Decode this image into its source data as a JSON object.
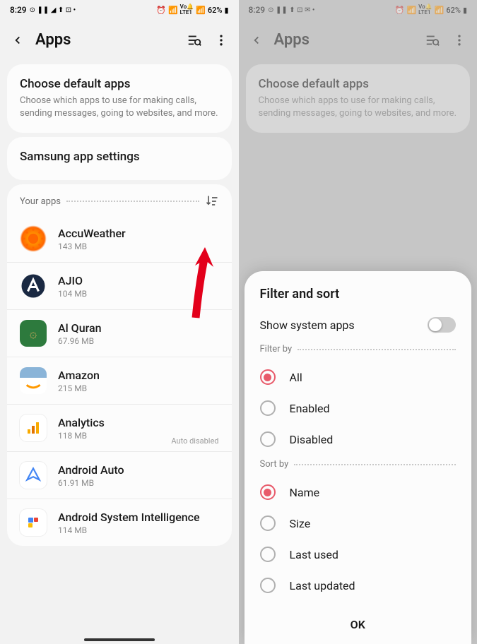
{
  "status": {
    "time": "8:29",
    "icons_left": "⊙ ⏸ ✈ ⬆ ⊡ •",
    "icons_right": "⏰ 📶",
    "lte": "VoLTE1",
    "signal": "📶",
    "battery_pct": "62%",
    "battery_icon": "🔲"
  },
  "header": {
    "title": "Apps"
  },
  "cards": {
    "default": {
      "title": "Choose default apps",
      "desc": "Choose which apps to use for making calls, sending messages, going to websites, and more."
    },
    "samsung": {
      "title": "Samsung app settings"
    }
  },
  "section": {
    "title": "Your apps"
  },
  "apps": [
    {
      "name": "AccuWeather",
      "size": "143 MB"
    },
    {
      "name": "AJIO",
      "size": "104 MB"
    },
    {
      "name": "Al Quran",
      "size": "67.96 MB"
    },
    {
      "name": "Amazon",
      "size": "215 MB"
    },
    {
      "name": "Analytics",
      "size": "118 MB",
      "tag": "Auto disabled"
    },
    {
      "name": "Android Auto",
      "size": "61.91 MB"
    },
    {
      "name": "Android System Intelligence",
      "size": "114 MB"
    }
  ],
  "sheet": {
    "title": "Filter and sort",
    "toggle_label": "Show system apps",
    "filter_label": "Filter by",
    "sort_label": "Sort by",
    "filters": [
      "All",
      "Enabled",
      "Disabled"
    ],
    "sorts": [
      "Name",
      "Size",
      "Last used",
      "Last updated"
    ],
    "ok": "OK"
  }
}
